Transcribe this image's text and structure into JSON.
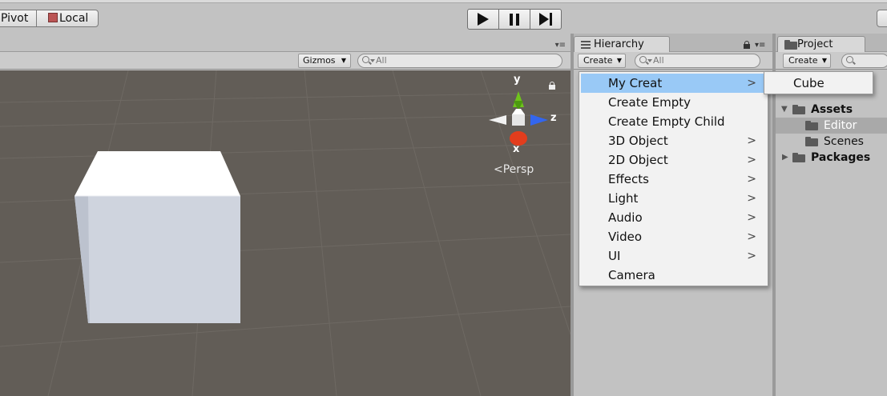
{
  "toolbar": {
    "pivot_label": "Pivot",
    "local_label": "Local",
    "play_icon": "play-icon",
    "pause_icon": "pause-icon",
    "step_icon": "step-icon"
  },
  "scene": {
    "gizmos_label": "Gizmos",
    "search_placeholder": "All",
    "persp_label": "Persp",
    "axis_labels": {
      "y": "y",
      "z": "z",
      "x": "x"
    },
    "colors": {
      "background": "#625d57",
      "grid": "#6e6963",
      "cube_front": "#c9ced9",
      "cube_top": "#ffffff",
      "axis_y": "#6fc41c",
      "axis_z": "#3366ee",
      "axis_x": "#e23d1d"
    }
  },
  "hierarchy": {
    "tab_label": "Hierarchy",
    "create_label": "Create",
    "search_placeholder": "All"
  },
  "project": {
    "tab_label": "Project",
    "create_label": "Create",
    "tree": [
      {
        "label": "Assets",
        "bold": true,
        "expanded": true,
        "level": 0
      },
      {
        "label": "Editor",
        "bold": false,
        "level": 1,
        "selected": true
      },
      {
        "label": "Scenes",
        "bold": false,
        "level": 1
      },
      {
        "label": "Packages",
        "bold": true,
        "expanded": false,
        "level": 0
      }
    ]
  },
  "context_menu": {
    "items": [
      {
        "label": "My Creat",
        "has_submenu": true,
        "highlighted": true
      },
      {
        "label": "Create Empty",
        "has_submenu": false
      },
      {
        "label": "Create Empty Child",
        "has_submenu": false
      },
      {
        "label": "3D Object",
        "has_submenu": true
      },
      {
        "label": "2D Object",
        "has_submenu": true
      },
      {
        "label": "Effects",
        "has_submenu": true
      },
      {
        "label": "Light",
        "has_submenu": true
      },
      {
        "label": "Audio",
        "has_submenu": true
      },
      {
        "label": "Video",
        "has_submenu": true
      },
      {
        "label": "UI",
        "has_submenu": true
      },
      {
        "label": "Camera",
        "has_submenu": false
      }
    ],
    "submenu": {
      "items": [
        {
          "label": "Cube"
        }
      ]
    },
    "highlight_color": "#99c9f6"
  }
}
